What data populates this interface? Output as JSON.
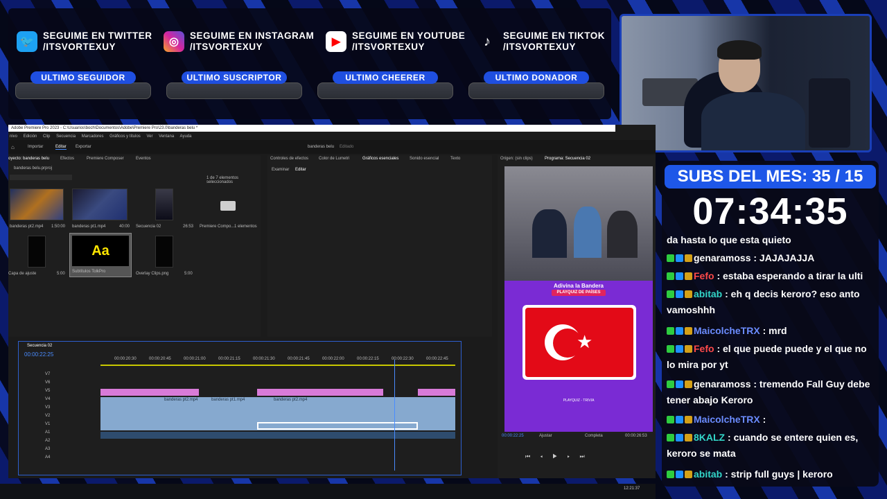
{
  "social": [
    {
      "icon": "twitter-icon",
      "line1": "SEGUIME EN TWITTER",
      "line2": "/ITSVORTEXUY",
      "color": "#1da1f2"
    },
    {
      "icon": "instagram-icon",
      "line1": "SEGUIME EN INSTAGRAM",
      "line2": "/ITSVORTEXUY",
      "color": "#d6249f"
    },
    {
      "icon": "youtube-icon",
      "line1": "SEGUIME EN YOUTUBE",
      "line2": "/ITSVORTEXUY",
      "color": "#ff0000"
    },
    {
      "icon": "tiktok-icon",
      "line1": "SEGUIME EN TIKTOK",
      "line2": "/ITSVORTEXUY",
      "color": "#000000"
    }
  ],
  "pills": [
    "ULTIMO SEGUIDOR",
    "ULTIMO SUSCRIPTOR",
    "ULTIMO CHEERER",
    "ULTIMO DONADOR"
  ],
  "subs": {
    "label": "SUBS DEL MES: 35 / 15",
    "timer": "07:34:35"
  },
  "chat": [
    {
      "user": "",
      "text": "da hasta lo que esta quieto",
      "color": "#ffffff"
    },
    {
      "user": "genaramoss",
      "text": " : JAJAJAJJA",
      "color": "#ffffff"
    },
    {
      "user": "Fefo",
      "text": " : estaba esperando a tirar la ulti",
      "color": "#ff4a4a"
    },
    {
      "user": "abitab",
      "text": " : eh q decis keroro? eso anto vamoshhh",
      "color": "#33d6c8"
    },
    {
      "user": "MaicolcheTRX",
      "text": " : mrd",
      "color": "#6b8cff"
    },
    {
      "user": "Fefo",
      "text": " : el que puede puede y el que no lo mira por yt",
      "color": "#ff4a4a"
    },
    {
      "user": "genaramoss",
      "text": " : tremendo Fall Guy debe tener abajo Keroro",
      "color": "#ffffff"
    },
    {
      "user": "MaicolcheTRX",
      "text": " : ",
      "color": "#6b8cff"
    },
    {
      "user": "8KALZ",
      "text": " : cuando se entere quien es, keroro se mata",
      "color": "#33d6c8"
    },
    {
      "user": "abitab",
      "text": " : strip full guys | keroro",
      "color": "#33d6c8"
    }
  ],
  "premiere": {
    "title": "Adobe Premiere Pro 2023 - C:\\Usuarios\\boch\\Documentos\\Adobe\\Premiere Pro\\23.0\\banderas belu *",
    "menu": [
      "nivo",
      "Edición",
      "Clip",
      "Secuencia",
      "Marcadores",
      "Gráficos y títulos",
      "Ver",
      "Ventana",
      "Ayuda"
    ],
    "header_tabs": [
      "Importar",
      "Editar",
      "Exportar"
    ],
    "project_name": "banderas belu",
    "edit_label": "Editado",
    "project_tabs": [
      "oyecto: banderas belu",
      "Efectos",
      "Premiere Composer",
      "Eventos"
    ],
    "project_file": "banderas belu.prproj",
    "selection_info": "1 de 7 elementos seleccionados",
    "bins": [
      {
        "name": "banderas pt2.mp4",
        "dur": "1:50:00"
      },
      {
        "name": "banderas pt1.mp4",
        "dur": "40:00"
      },
      {
        "name": "Secuencia 02",
        "dur": "26:53"
      },
      {
        "name": "Premiere Compo...",
        "dur": "1 elementos"
      },
      {
        "name": "Capa de ajuste",
        "dur": "5:00"
      },
      {
        "name": "Subtítulos TolkPro",
        "dur": ""
      },
      {
        "name": "Overlay Clips.png",
        "dur": "5:00"
      }
    ],
    "aa_label": "Aa",
    "panel_tabs": [
      "Controles de efectos",
      "Color de Lumetri",
      "Gráficos esenciales",
      "Sonido esencial",
      "Texto"
    ],
    "graph_tabs": [
      "Examinar",
      "Editar"
    ],
    "monitor_tabs": [
      "Origen: (sin clips)",
      "Programa: Secuencia 02"
    ],
    "sequence": "Secuencia 02",
    "timecode": "00:00:22:25",
    "ruler": [
      "00:00:20:30",
      "00:00:20:45",
      "00:00:21:00",
      "00:00:21:15",
      "00:00:21:30",
      "00:00:21:45",
      "00:00:22:00",
      "00:00:22:15",
      "00:00:22:30",
      "00:00:22:45"
    ],
    "tracks": [
      "V7",
      "V6",
      "V5",
      "V4",
      "V3",
      "V2",
      "V1",
      "A1",
      "A2",
      "A3",
      "A4"
    ],
    "clip_name": "banderas pt2.mp4",
    "clip_name2": "banderas pt1.mp4",
    "fit": "Ajustar",
    "quality": "Completa",
    "prog_time": "00:00:22:25",
    "prog_dur": "00:00:26:53",
    "video_title": "Adivina la Bandera",
    "video_sub": "PLAYQUIZ DE PAÍSES",
    "video_footer": "PLAYQUIZ - TRIVIA",
    "clock": "12:21:37"
  }
}
